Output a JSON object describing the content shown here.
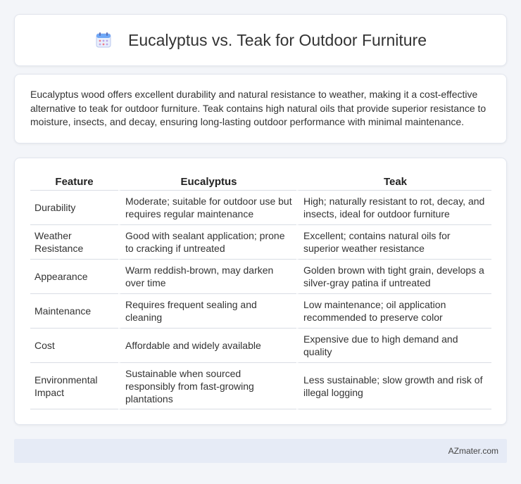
{
  "header": {
    "title": "Eucalyptus vs. Teak for Outdoor Furniture",
    "icon": "calendar-icon",
    "icon_colors": [
      "#6ea8f7",
      "#f07b8a",
      "#b9a6e8"
    ]
  },
  "summary": {
    "text": "Eucalyptus wood offers excellent durability and natural resistance to weather, making it a cost-effective alternative to teak for outdoor furniture. Teak contains high natural oils that provide superior resistance to moisture, insects, and decay, ensuring long-lasting outdoor performance with minimal maintenance."
  },
  "table": {
    "headers": [
      "Feature",
      "Eucalyptus",
      "Teak"
    ],
    "rows": [
      [
        "Durability",
        "Moderate; suitable for outdoor use but requires regular maintenance",
        "High; naturally resistant to rot, decay, and insects, ideal for outdoor furniture"
      ],
      [
        "Weather Resistance",
        "Good with sealant application; prone to cracking if untreated",
        "Excellent; contains natural oils for superior weather resistance"
      ],
      [
        "Appearance",
        "Warm reddish-brown, may darken over time",
        "Golden brown with tight grain, develops a silver-gray patina if untreated"
      ],
      [
        "Maintenance",
        "Requires frequent sealing and cleaning",
        "Low maintenance; oil application recommended to preserve color"
      ],
      [
        "Cost",
        "Affordable and widely available",
        "Expensive due to high demand and quality"
      ],
      [
        "Environmental Impact",
        "Sustainable when sourced responsibly from fast-growing plantations",
        "Less sustainable; slow growth and risk of illegal logging"
      ]
    ]
  },
  "footer": {
    "brand": "AZmater.com"
  }
}
